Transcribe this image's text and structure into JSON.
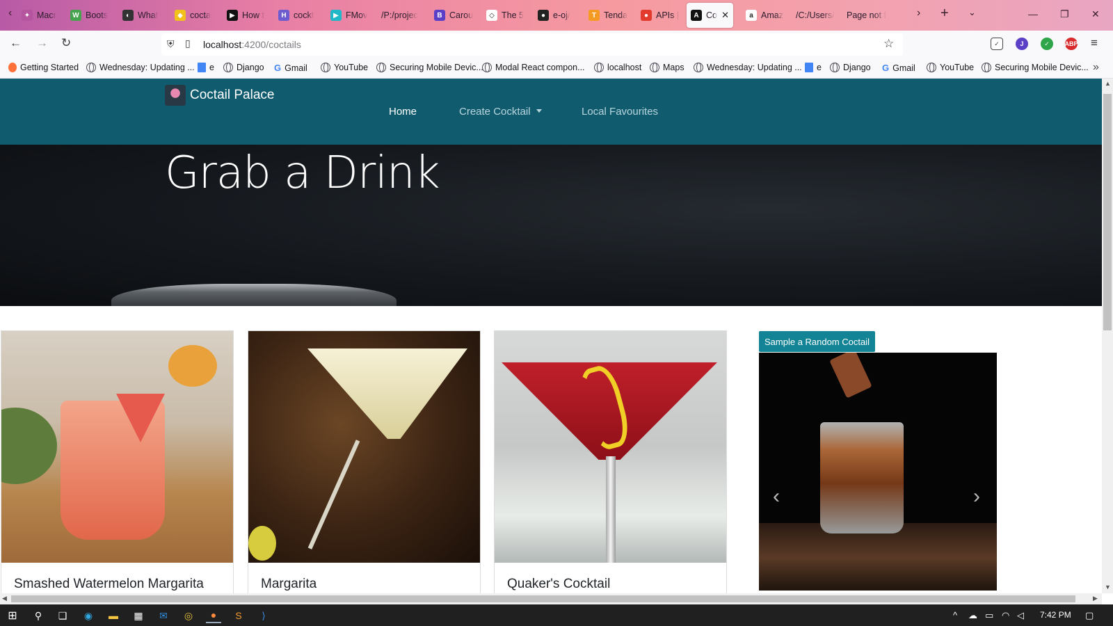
{
  "browser": {
    "tabs": [
      {
        "title": "Macr",
        "color": "#b6559f",
        "glyph": "✦"
      },
      {
        "title": "Boots",
        "color": "#46a34e",
        "glyph": "W"
      },
      {
        "title": "What",
        "color": "#333333",
        "glyph": "◐"
      },
      {
        "title": "cocta",
        "color": "#f2c01a",
        "glyph": "◆"
      },
      {
        "title": "How t",
        "color": "#111111",
        "glyph": "▶"
      },
      {
        "title": "cockt",
        "color": "#6d5bd0",
        "glyph": "H"
      },
      {
        "title": "FMov",
        "color": "#1fb8c9",
        "glyph": "▶"
      },
      {
        "title": "/P:/projec",
        "color": "",
        "glyph": ""
      },
      {
        "title": "Carou",
        "color": "#5b3fc7",
        "glyph": "B"
      },
      {
        "title": "The 5",
        "color": "#ffffff",
        "glyph": "◇"
      },
      {
        "title": "e-oj/",
        "color": "#222222",
        "glyph": "●"
      },
      {
        "title": "Tenda",
        "color": "#f59a23",
        "glyph": "T"
      },
      {
        "title": "APIs |",
        "color": "#e23b2e",
        "glyph": "●"
      },
      {
        "title": "Co",
        "color": "#111111",
        "glyph": "A",
        "active": true
      },
      {
        "title": "Amaz",
        "color": "#ffffff",
        "glyph": "a"
      },
      {
        "title": "/C:/Users/",
        "color": "",
        "glyph": ""
      },
      {
        "title": "Page not f",
        "color": "",
        "glyph": ""
      }
    ],
    "url_host": "localhost",
    "url_rest": ":4200/coctails",
    "bookmarks": [
      {
        "label": "Getting Started",
        "icon": "firefox"
      },
      {
        "label": "Wednesday: Updating ...",
        "icon": "globe"
      },
      {
        "label": "e",
        "icon": "doc"
      },
      {
        "label": "Django",
        "icon": "globe"
      },
      {
        "label": "Gmail",
        "icon": "google"
      },
      {
        "label": "YouTube",
        "icon": "globe"
      },
      {
        "label": "Securing Mobile Devic...",
        "icon": "globe"
      },
      {
        "label": "Modal React compon...",
        "icon": "globe"
      },
      {
        "label": "localhost",
        "icon": "globe"
      },
      {
        "label": "Maps",
        "icon": "globe"
      },
      {
        "label": "Wednesday: Updating ...",
        "icon": "globe"
      },
      {
        "label": "e",
        "icon": "doc"
      },
      {
        "label": "Django",
        "icon": "globe"
      },
      {
        "label": "Gmail",
        "icon": "google"
      },
      {
        "label": "YouTube",
        "icon": "globe"
      },
      {
        "label": "Securing Mobile Devic...",
        "icon": "globe"
      }
    ]
  },
  "site": {
    "brand": "Coctail Palace",
    "nav": {
      "home": "Home",
      "create": "Create Cocktail",
      "favourites": "Local Favourites"
    },
    "hero_title": "Grab a Drink",
    "cards": [
      {
        "title": "Smashed Watermelon Margarita"
      },
      {
        "title": "Margarita"
      },
      {
        "title": "Quaker's Cocktail"
      }
    ],
    "random_button": "Sample a Random Coctail"
  },
  "taskbar": {
    "time": "7:42 PM"
  },
  "colors": {
    "navbar": "#115b6e",
    "button": "#138496"
  }
}
